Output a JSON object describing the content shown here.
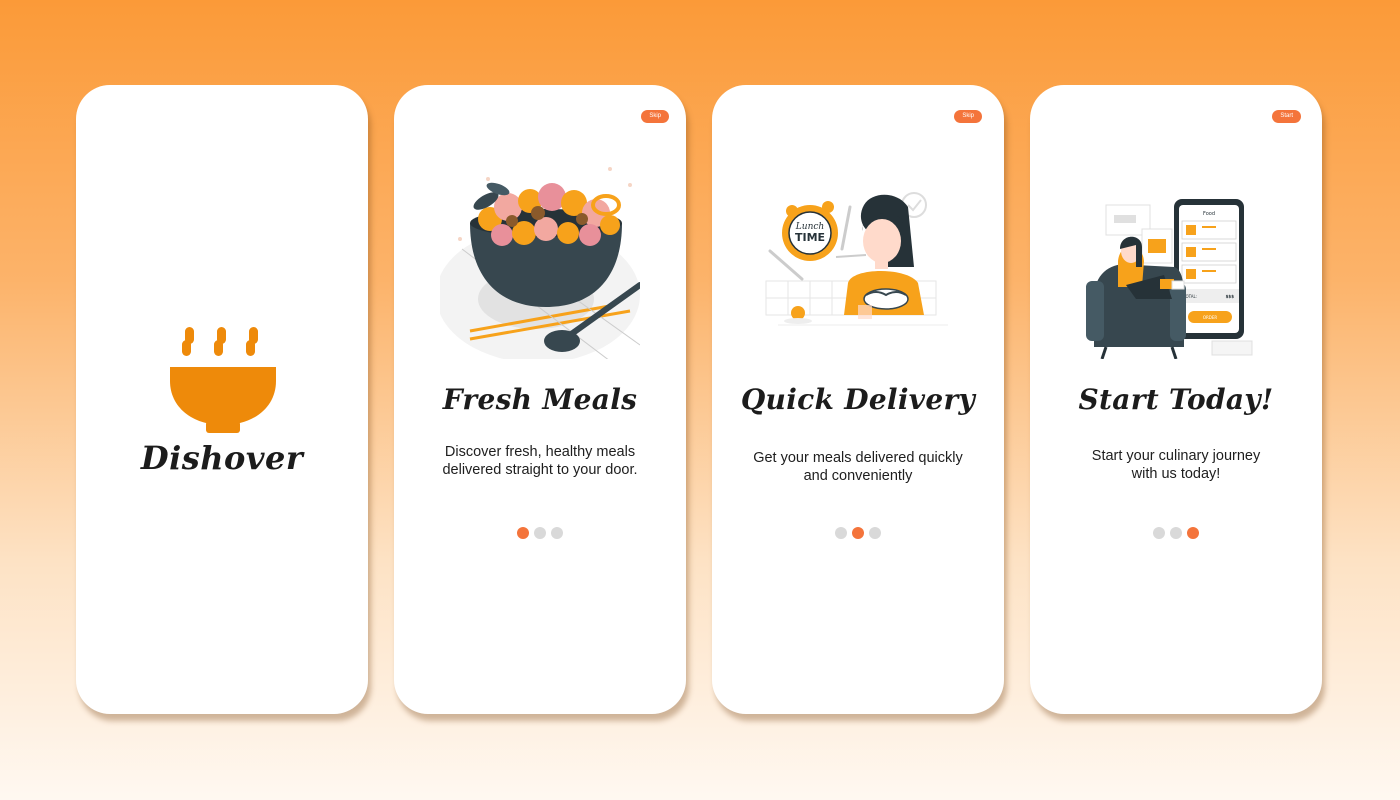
{
  "screens": [
    {
      "id": "splash",
      "brand": "Dishover"
    },
    {
      "id": "fresh-meals",
      "action": "Skip",
      "title": "Fresh Meals",
      "description": "Discover fresh, healthy meals delivered straight to your door.",
      "active_dot": 0
    },
    {
      "id": "quick-delivery",
      "action": "Skip",
      "title": "Quick Delivery",
      "description": "Get your meals delivered quickly and conveniently",
      "active_dot": 1
    },
    {
      "id": "start-today",
      "action": "Start",
      "title": "Start Today!",
      "description": "Start your culinary journey with us today!",
      "active_dot": 2
    }
  ],
  "illustrations": {
    "delivery_sign_line1": "Lunch",
    "delivery_sign_line2": "TIME",
    "app_header": "Food",
    "app_total_label": "TOTAL:",
    "app_total_value": "$$$",
    "app_order_button": "ORDER"
  },
  "colors": {
    "accent": "#f4743b",
    "brand_orange": "#ee8a0a",
    "illus_orange": "#f7a21b",
    "dark": "#37474f",
    "dot_inactive": "#d9d9d9"
  },
  "icons": [
    "bowl-logo-icon",
    "salad-bowl-illustration",
    "lunch-time-illustration",
    "food-app-illustration"
  ]
}
